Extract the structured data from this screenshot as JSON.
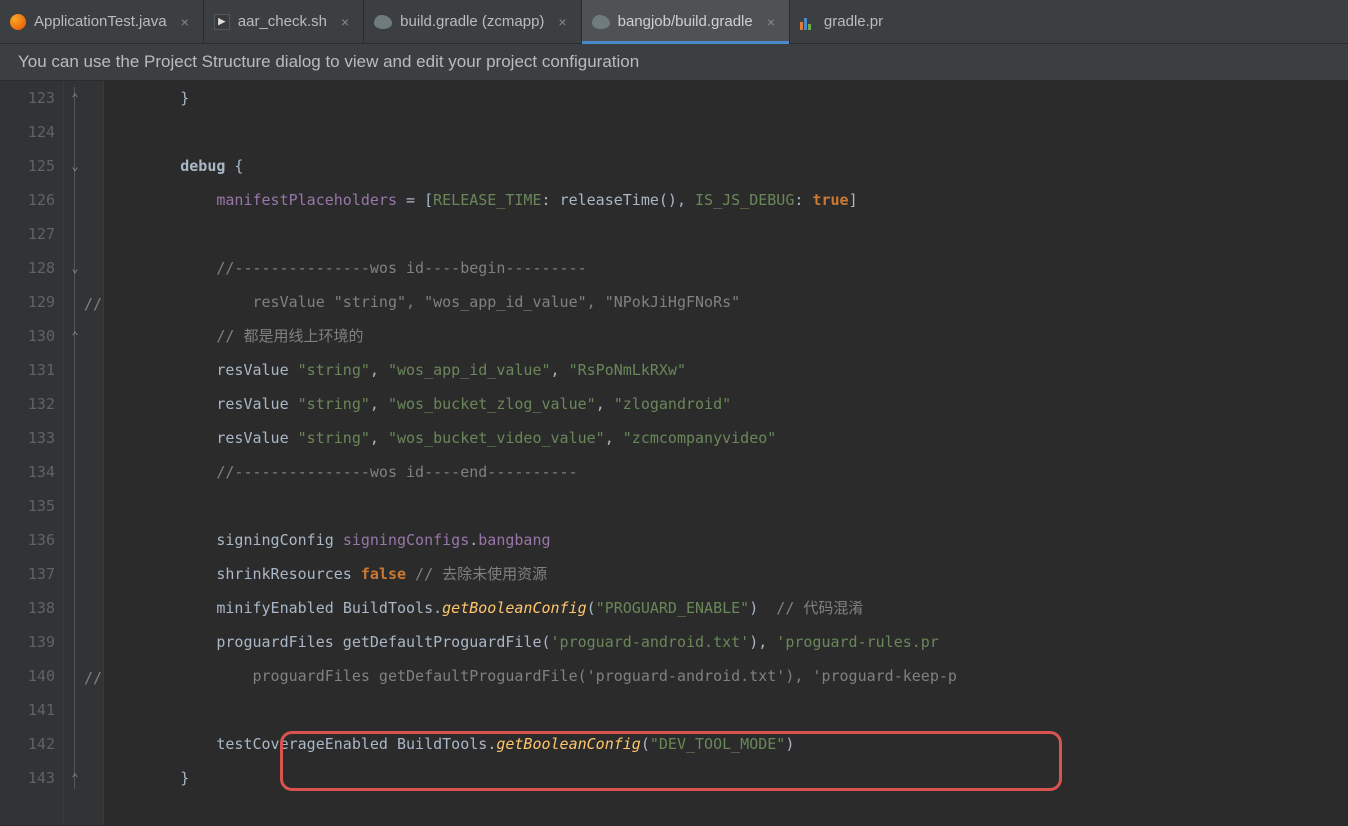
{
  "tabs": [
    {
      "label": "ApplicationTest.java",
      "icon": "java",
      "active": false
    },
    {
      "label": "aar_check.sh",
      "icon": "sh",
      "active": false
    },
    {
      "label": "build.gradle (zcmapp)",
      "icon": "gradle",
      "active": false
    },
    {
      "label": "bangjob/build.gradle",
      "icon": "gradle",
      "active": true
    },
    {
      "label": "gradle.pr",
      "icon": "chart",
      "active": false,
      "truncated": true
    }
  ],
  "info_bar": "You can use the Project Structure dialog to view and edit your project configuration",
  "first_line_number": 123,
  "line_numbers": [
    "123",
    "124",
    "125",
    "126",
    "127",
    "128",
    "129",
    "130",
    "131",
    "132",
    "133",
    "134",
    "135",
    "136",
    "137",
    "138",
    "139",
    "140",
    "141",
    "142",
    "143"
  ],
  "gutter_comment_markers": {
    "129": "//",
    "140": "//"
  },
  "code": {
    "l123": {
      "indent": "        ",
      "brace": "}"
    },
    "l124": "",
    "l125": {
      "indent": "        ",
      "kw": "debug",
      "brace": " {"
    },
    "l126": {
      "indent": "            ",
      "field": "manifestPlaceholders",
      "eq": " = [",
      "k1": "RELEASE_TIME",
      "sep1": ": ",
      "v1": "releaseTime()",
      "sep2": ", ",
      "k2": "IS_JS_DEBUG",
      "sep3": ": ",
      "v2": "true",
      "close": "]"
    },
    "l127": "",
    "l128": {
      "indent": "            ",
      "cmt": "//---------------wos id----begin---------"
    },
    "l129": {
      "indent": "                ",
      "fn": "resValue ",
      "s1": "\"string\"",
      "c1": ", ",
      "s2": "\"wos_app_id_value\"",
      "c2": ", ",
      "s3": "\"NPokJiHgFNoRs\""
    },
    "l130": {
      "indent": "            ",
      "cmt": "// 都是用线上环境的"
    },
    "l131": {
      "indent": "            ",
      "fn": "resValue ",
      "s1": "\"string\"",
      "c1": ", ",
      "s2": "\"wos_app_id_value\"",
      "c2": ", ",
      "s3": "\"RsPoNmLkRXw\""
    },
    "l132": {
      "indent": "            ",
      "fn": "resValue ",
      "s1": "\"string\"",
      "c1": ", ",
      "s2": "\"wos_bucket_zlog_value\"",
      "c2": ", ",
      "s3": "\"zlogandroid\""
    },
    "l133": {
      "indent": "            ",
      "fn": "resValue ",
      "s1": "\"string\"",
      "c1": ", ",
      "s2": "\"wos_bucket_video_value\"",
      "c2": ", ",
      "s3": "\"zcmcompanyvideo\""
    },
    "l134": {
      "indent": "            ",
      "cmt": "//---------------wos id----end----------"
    },
    "l135": "",
    "l136": {
      "indent": "            ",
      "fn": "signingConfig ",
      "field": "signingConfigs",
      "dot": ".",
      "field2": "bangbang"
    },
    "l137": {
      "indent": "            ",
      "fn": "shrinkResources ",
      "kw": "false",
      "cmt": " // 去除未使用资源"
    },
    "l138": {
      "indent": "            ",
      "fn": "minifyEnabled ",
      "cls": "BuildTools",
      "dot": ".",
      "call": "getBooleanConfig",
      "open": "(",
      "s1": "\"PROGUARD_ENABLE\"",
      "close": ")",
      "cmt": "  // 代码混淆"
    },
    "l139": {
      "indent": "            ",
      "fn": "proguardFiles getDefaultProguardFile(",
      "s1": "'proguard-android.txt'",
      "mid": "), ",
      "s2": "'proguard-rules.pr"
    },
    "l140": {
      "indent": "                ",
      "fn": "proguardFiles getDefaultProguardFile(",
      "s1": "'proguard-android.txt'",
      "mid": "), ",
      "s2": "'proguard-keep-p"
    },
    "l141": "",
    "l142": {
      "indent": "            ",
      "fn": "testCoverageEnabled ",
      "cls": "BuildTools",
      "dot": ".",
      "call": "getBooleanConfig",
      "open": "(",
      "s1": "\"DEV_TOOL_MODE\"",
      "close": ")"
    },
    "l143": {
      "indent": "        ",
      "brace": "}"
    }
  },
  "close_glyph": "×",
  "sh_icon_text": "▶"
}
